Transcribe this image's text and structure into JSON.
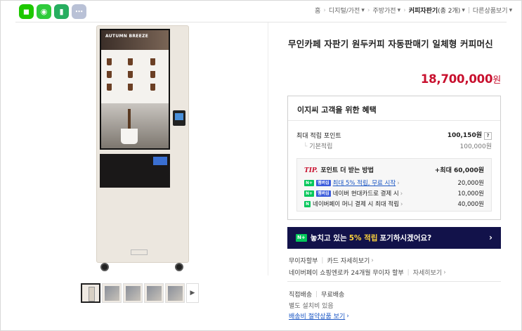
{
  "share_buttons": [
    {
      "name": "talk-share",
      "color": "#1ec800",
      "glyph": "◼"
    },
    {
      "name": "band-share",
      "color": "#2fcb3b",
      "glyph": "◉"
    },
    {
      "name": "bookmark-share",
      "color": "#27ae60",
      "glyph": "▮"
    },
    {
      "name": "more-share",
      "color": "#b9c1d6",
      "glyph": "⋯"
    }
  ],
  "breadcrumb": {
    "items": [
      "홈",
      "디지털/가전",
      "주방가전",
      "커피자판기",
      "다른상품보기"
    ],
    "current_count": "(총 2개)"
  },
  "product": {
    "image_screen_text": "AUTUMN BREEZE",
    "title": "무인카페 자판기 원두커피 자동판매기 일체형 커피머신",
    "price": "18,700,000",
    "price_unit": "원"
  },
  "benefits": {
    "header": "이지씨 고객을 위한 혜택",
    "max_points_label": "최대 적립 포인트",
    "max_points_value": "100,150원",
    "basic_label": "기본적립",
    "basic_value": "100,000원",
    "tip_label": "TIP.",
    "tip_text": "포인트 더 받는 방법",
    "tip_max": "+최대 60,000원",
    "tip_items": [
      {
        "badge": "멤버십",
        "text": "최대 5% 적립, 무료 시작",
        "value": "20,000원"
      },
      {
        "badge": "멤버십",
        "text": "네이버 현대카드로 결제 시",
        "value": "10,000원"
      },
      {
        "badge": "",
        "text": "네이버페이 머니 결제 시 최대 적립",
        "value": "40,000원"
      }
    ]
  },
  "banner": {
    "text_before": "놓치고 있는",
    "highlight": "5% 적립",
    "text_after": "포기하시겠어요?"
  },
  "payment": {
    "installment": "무이자할부",
    "card_detail": "카드 자세히보기",
    "npay_text": "네이버페이 쇼핑엔로카 24개월 무이자 할부",
    "npay_detail": "자세히보기"
  },
  "shipping": {
    "type": "직접배송",
    "fee": "무료배송",
    "extra": "별도 설치비 있음",
    "link": "배송비 절약상품 보기"
  }
}
